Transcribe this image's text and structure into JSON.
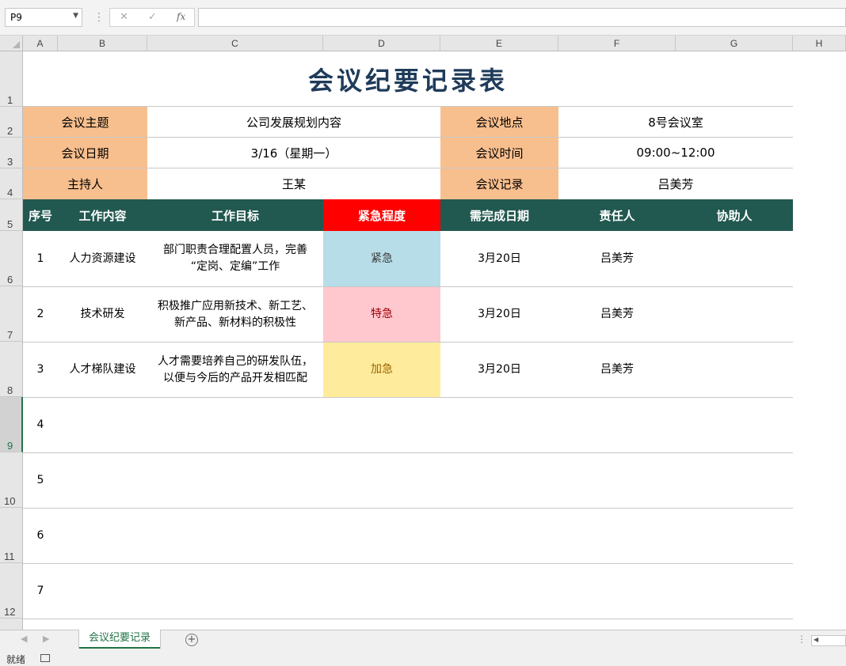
{
  "formula_bar": {
    "name_box": "P9",
    "cancel_icon": "✕",
    "enter_icon": "✓",
    "fx_label": "fx",
    "formula": ""
  },
  "columns": [
    "A",
    "B",
    "C",
    "D",
    "E",
    "F",
    "G",
    "H"
  ],
  "rows": [
    "1",
    "2",
    "3",
    "4",
    "5",
    "6",
    "7",
    "8",
    "9",
    "10",
    "11",
    "12"
  ],
  "sheet": {
    "title": "会议纪要记录表",
    "info": {
      "topic_label": "会议主题",
      "topic_value": "公司发展规划内容",
      "place_label": "会议地点",
      "place_value": "8号会议室",
      "date_label": "会议日期",
      "date_value": "3/16（星期一）",
      "time_label": "会议时间",
      "time_value": "09:00~12:00",
      "host_label": "主持人",
      "host_value": "王某",
      "recorder_label": "会议记录",
      "recorder_value": "吕美芳"
    },
    "headers": [
      "序号",
      "工作内容",
      "工作目标",
      "紧急程度",
      "需完成日期",
      "责任人",
      "协助人"
    ],
    "tasks": [
      {
        "no": "1",
        "content": "人力资源建设",
        "goal_line1": "部门职责合理配置人员，完善",
        "goal_line2": "“定岗、定编”工作",
        "urgency": "紧急",
        "due": "3月20日",
        "owner": "吕美芳",
        "assistant": ""
      },
      {
        "no": "2",
        "content": "技术研发",
        "goal_line1": "积极推广应用新技术、新工艺、",
        "goal_line2": "新产品、新材料的积极性",
        "urgency": "特急",
        "due": "3月20日",
        "owner": "吕美芳",
        "assistant": ""
      },
      {
        "no": "3",
        "content": "人才梯队建设",
        "goal_line1": "人才需要培养自己的研发队伍，",
        "goal_line2": "以便与今后的产品开发相匹配",
        "urgency": "加急",
        "due": "3月20日",
        "owner": "吕美芳",
        "assistant": ""
      }
    ],
    "empty_numbers": [
      "4",
      "5",
      "6",
      "7"
    ]
  },
  "tabs": {
    "active": "会议纪要记录",
    "add": "+"
  },
  "status": {
    "ready": "就绪"
  },
  "colors": {
    "label_fill": "#f8bf8e",
    "header_fill": "#215850",
    "urgency_header": "#ff0000",
    "urgent": "#b7dde8",
    "very_urgent": "#ffc7ce",
    "expedited": "#ffeb9c",
    "title": "#1f3b5a",
    "accent": "#217346"
  }
}
